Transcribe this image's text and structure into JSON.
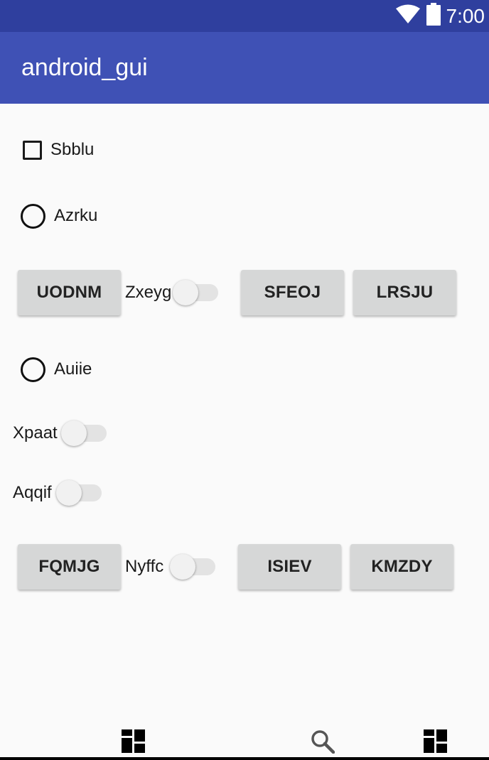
{
  "status_bar": {
    "time": "7:00",
    "icons": [
      "wifi-icon",
      "battery-icon"
    ]
  },
  "app_bar": {
    "title": "android_gui"
  },
  "controls": {
    "checkbox_sbblu": {
      "label": "Sbblu",
      "checked": false
    },
    "radio_azrku": {
      "label": "Azrku",
      "selected": false
    },
    "row1": {
      "button1": "UODNM",
      "switch": {
        "label": "Zxeyg",
        "on": false
      },
      "button2": "SFEOJ",
      "button3": "LRSJU"
    },
    "radio_auiie": {
      "label": "Auiie",
      "selected": false
    },
    "switch_xpaat": {
      "label": "Xpaat",
      "on": false
    },
    "switch_aqqif": {
      "label": "Aqqif",
      "on": false
    },
    "row2": {
      "button1": "FQMJG",
      "switch": {
        "label": "Nyffc",
        "on": false
      },
      "button2": "ISIEV",
      "button3": "KMZDY"
    }
  },
  "nav_bar": {
    "icons": [
      "dashboard-icon",
      "search-icon",
      "dashboard-icon"
    ]
  },
  "colors": {
    "status_bar": "#2f3f9e",
    "app_bar": "#3f51b5",
    "background": "#fafafa",
    "button": "#d6d7d7"
  }
}
